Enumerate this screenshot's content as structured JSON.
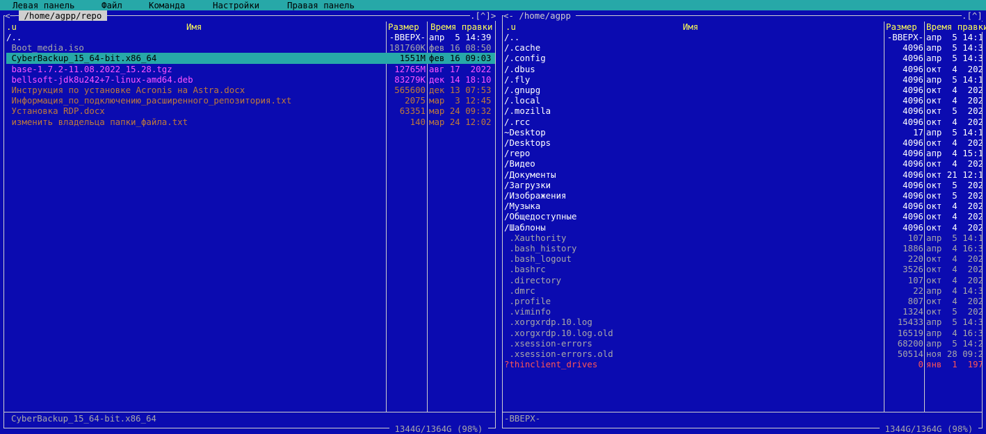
{
  "menu": {
    "items": [
      "Левая панель",
      "Файл",
      "Команда",
      "Настройки",
      "Правая панель"
    ]
  },
  "left": {
    "path": " /home/agpp/repo ",
    "corner": ".[^]>",
    "col_u": ".u",
    "col_name": "Имя",
    "col_size": "Размер",
    "col_time": "Время правки",
    "status": "CyberBackup_15_64-bit.x86_64",
    "free": " 1344G/1364G (98%) ",
    "rows": [
      {
        "name": "/..",
        "size": "-ВВЕРХ-",
        "time": "апр  5 14:39",
        "kind": "updir"
      },
      {
        "name": " Boot_media.iso",
        "size": "181760K",
        "time": "фев 16 08:50",
        "kind": "plain"
      },
      {
        "name": " CyberBackup_15_64-bit.x86_64",
        "size": "1551M",
        "time": "фев 16 09:03",
        "kind": "plain",
        "selected": true
      },
      {
        "name": " base-1.7.2-11.08.2022_15.28.tgz",
        "size": "12765M",
        "time": "авг 17  2022",
        "kind": "arch"
      },
      {
        "name": " bellsoft-jdk8u242+7-linux-amd64.deb",
        "size": "83279K",
        "time": "дек 14 18:10",
        "kind": "arch"
      },
      {
        "name": " Инструкция по установке Acronis на Astra.docx",
        "size": "565600",
        "time": "дек 13 07:53",
        "kind": "doc"
      },
      {
        "name": " Информация_по_подключению_расширенного_репозитория.txt",
        "size": "2075",
        "time": "мар  3 12:45",
        "kind": "doc"
      },
      {
        "name": " Установка RDP.docx",
        "size": "63351",
        "time": "мар 24 09:32",
        "kind": "doc"
      },
      {
        "name": " изменить владельца папки_файла.txt",
        "size": "140",
        "time": "мар 24 12:02",
        "kind": "doc"
      }
    ]
  },
  "right": {
    "path": "<- /home/agpp ",
    "corner": ".[^]",
    "col_u": ".u",
    "col_name": "Имя",
    "col_size": "Размер",
    "col_time": "Время правки",
    "status": "-ВВЕРХ-",
    "free": " 1344G/1364G (98%) ",
    "rows": [
      {
        "name": "/..",
        "size": "-ВВЕРХ-",
        "time": "апр  5 14:1",
        "kind": "updir"
      },
      {
        "name": "/.cache",
        "size": "4096",
        "time": "апр  5 14:3",
        "kind": "dir"
      },
      {
        "name": "/.config",
        "size": "4096",
        "time": "апр  5 14:3",
        "kind": "dir"
      },
      {
        "name": "/.dbus",
        "size": "4096",
        "time": "окт  4  202",
        "kind": "dir"
      },
      {
        "name": "/.fly",
        "size": "4096",
        "time": "апр  5 14:1",
        "kind": "dir"
      },
      {
        "name": "/.gnupg",
        "size": "4096",
        "time": "окт  4  202",
        "kind": "dir"
      },
      {
        "name": "/.local",
        "size": "4096",
        "time": "окт  4  202",
        "kind": "dir"
      },
      {
        "name": "/.mozilla",
        "size": "4096",
        "time": "окт  5  202",
        "kind": "dir"
      },
      {
        "name": "/.rcc",
        "size": "4096",
        "time": "окт  4  202",
        "kind": "dir"
      },
      {
        "name": "~Desktop",
        "size": "17",
        "time": "апр  5 14:1",
        "kind": "dir"
      },
      {
        "name": "/Desktops",
        "size": "4096",
        "time": "окт  4  202",
        "kind": "dir"
      },
      {
        "name": "/repo",
        "size": "4096",
        "time": "апр  4 15:1",
        "kind": "dir"
      },
      {
        "name": "/Видео",
        "size": "4096",
        "time": "окт  4  202",
        "kind": "dir"
      },
      {
        "name": "/Документы",
        "size": "4096",
        "time": "окт 21 12:1",
        "kind": "dir"
      },
      {
        "name": "/Загрузки",
        "size": "4096",
        "time": "окт  5  202",
        "kind": "dir"
      },
      {
        "name": "/Изображения",
        "size": "4096",
        "time": "окт  5  202",
        "kind": "dir"
      },
      {
        "name": "/Музыка",
        "size": "4096",
        "time": "окт  4  202",
        "kind": "dir"
      },
      {
        "name": "/Общедоступные",
        "size": "4096",
        "time": "окт  4  202",
        "kind": "dir"
      },
      {
        "name": "/Шаблоны",
        "size": "4096",
        "time": "окт  4  202",
        "kind": "dir"
      },
      {
        "name": " .Xauthority",
        "size": "107",
        "time": "апр  5 14:1",
        "kind": "dot"
      },
      {
        "name": " .bash_history",
        "size": "1886",
        "time": "апр  4 16:3",
        "kind": "dot"
      },
      {
        "name": " .bash_logout",
        "size": "220",
        "time": "окт  4  202",
        "kind": "dot"
      },
      {
        "name": " .bashrc",
        "size": "3526",
        "time": "окт  4  202",
        "kind": "dot"
      },
      {
        "name": " .directory",
        "size": "107",
        "time": "окт  4  202",
        "kind": "dot"
      },
      {
        "name": " .dmrc",
        "size": "22",
        "time": "апр  4 14:3",
        "kind": "dot"
      },
      {
        "name": " .profile",
        "size": "807",
        "time": "окт  4  202",
        "kind": "dot"
      },
      {
        "name": " .viminfo",
        "size": "1324",
        "time": "окт  5  202",
        "kind": "dot"
      },
      {
        "name": " .xorgxrdp.10.log",
        "size": "15433",
        "time": "апр  5 14:3",
        "kind": "dot"
      },
      {
        "name": " .xorgxrdp.10.log.old",
        "size": "16519",
        "time": "апр  4 16:3",
        "kind": "dot"
      },
      {
        "name": " .xsession-errors",
        "size": "68200",
        "time": "апр  5 14:2",
        "kind": "dot"
      },
      {
        "name": " .xsession-errors.old",
        "size": "50514",
        "time": "ноя 28 09:2",
        "kind": "dot"
      },
      {
        "name": "?thinclient_drives",
        "size": "0",
        "time": "янв  1  197",
        "kind": "err"
      }
    ]
  }
}
